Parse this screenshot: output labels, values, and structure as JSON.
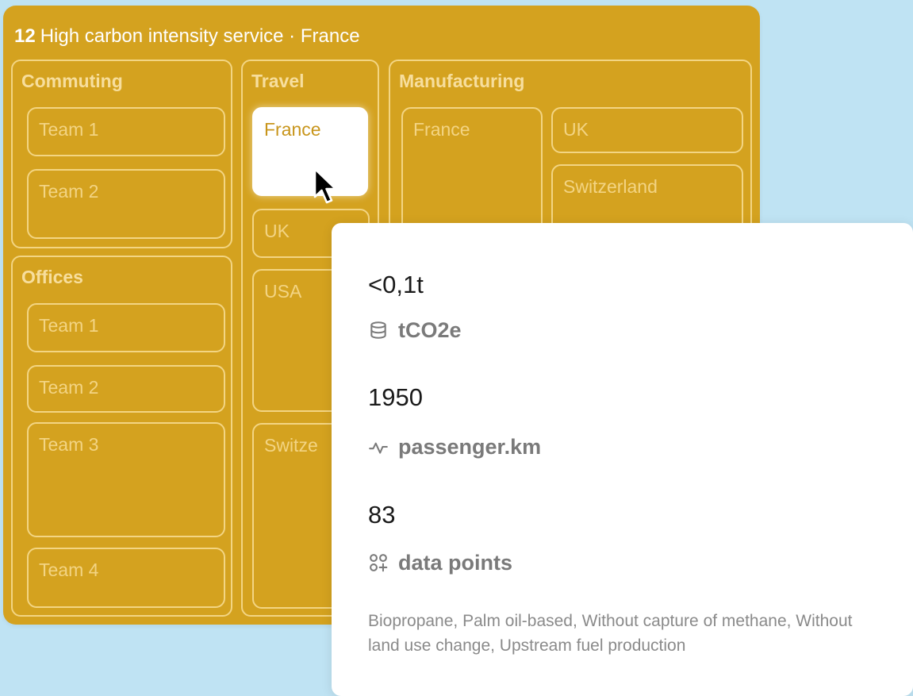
{
  "panel": {
    "rank": "12",
    "title": "High carbon intensity service · France",
    "groups": {
      "commuting": {
        "label": "Commuting",
        "cells": [
          "Team 1",
          "Team 2"
        ]
      },
      "offices": {
        "label": "Offices",
        "cells": [
          "Team 1",
          "Team 2",
          "Team 3",
          "Team 4"
        ]
      },
      "travel": {
        "label": "Travel",
        "cells": [
          "France",
          "UK",
          "USA",
          "Switze"
        ],
        "active_cell": "France"
      },
      "manufacturing": {
        "label": "Manufacturing",
        "cells": [
          "France",
          "UK",
          "Switzerland"
        ]
      }
    }
  },
  "card": {
    "emissions": {
      "value": "<0,1t",
      "unit": "tCO2e",
      "icon": "database-icon"
    },
    "activity": {
      "value": "1950",
      "unit": "passenger.km",
      "icon": "activity-icon"
    },
    "data_points": {
      "value": "83",
      "unit": "data points",
      "icon": "data-points-icon"
    },
    "description": "Biopropane, Palm oil-based, Without capture of methane, Without land use change, Upstream fuel production"
  },
  "colors": {
    "background": "#bfe3f3",
    "panel": "#d4a21f",
    "card": "#ffffff",
    "active_label": "#c8951b"
  }
}
